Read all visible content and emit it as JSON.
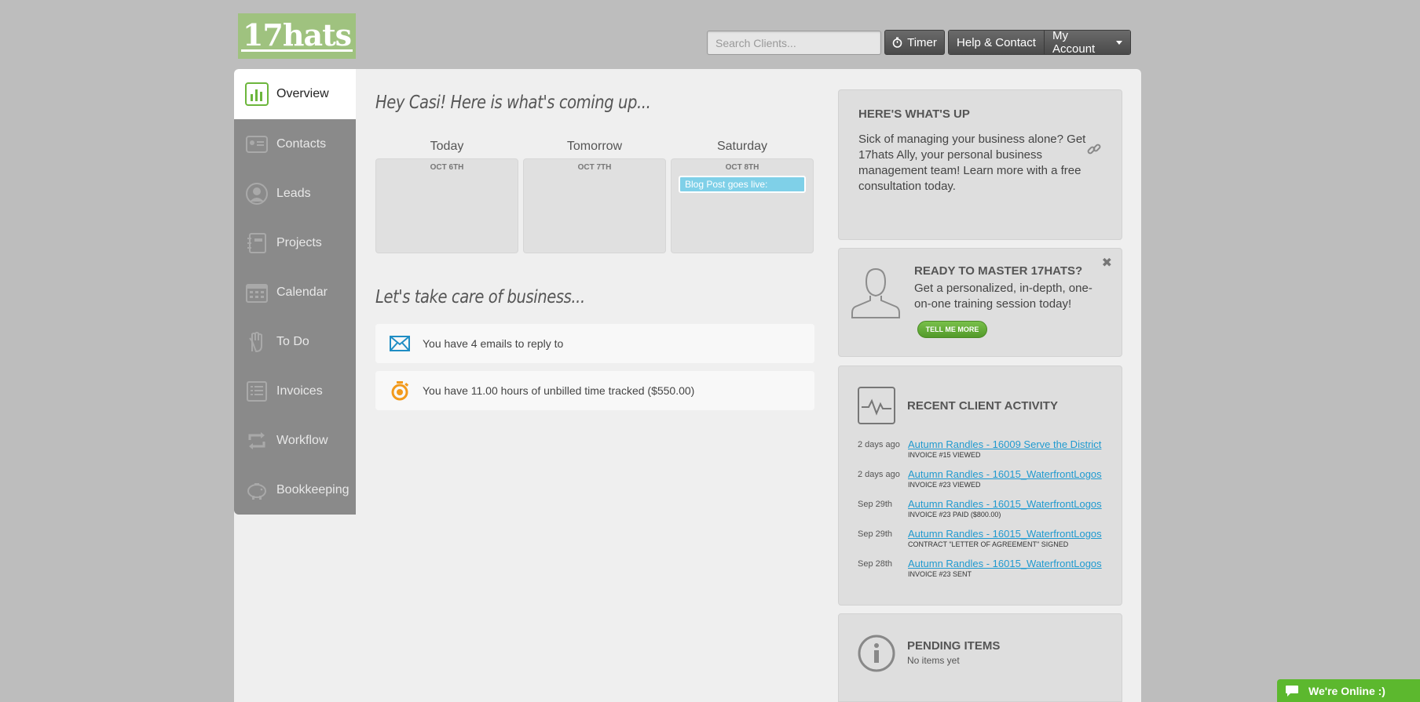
{
  "header": {
    "logo_text": "17hats",
    "search_placeholder": "Search Clients...",
    "timer_label": "Timer",
    "help_label": "Help & Contact",
    "account_label": "My Account"
  },
  "sidebar": {
    "items": [
      {
        "label": "Overview",
        "icon": "bar-chart-icon",
        "active": true
      },
      {
        "label": "Contacts",
        "icon": "contacts-icon"
      },
      {
        "label": "Leads",
        "icon": "person-circle-icon"
      },
      {
        "label": "Projects",
        "icon": "notebook-icon"
      },
      {
        "label": "Calendar",
        "icon": "calendar-icon"
      },
      {
        "label": "To Do",
        "icon": "hand-icon"
      },
      {
        "label": "Invoices",
        "icon": "invoice-icon"
      },
      {
        "label": "Workflow",
        "icon": "workflow-icon"
      },
      {
        "label": "Bookkeeping",
        "icon": "piggy-bank-icon"
      }
    ]
  },
  "main": {
    "greeting": "Hey Casi! Here is what's coming up...",
    "days": [
      {
        "name": "Today",
        "date": "OCT 6TH",
        "events": []
      },
      {
        "name": "Tomorrow",
        "date": "OCT 7TH",
        "events": []
      },
      {
        "name": "Saturday",
        "date": "OCT 8TH",
        "events": [
          "Blog Post goes live:"
        ]
      }
    ],
    "business_title": "Let's take care of business...",
    "tasks": [
      {
        "text": "You have 4 emails to reply to",
        "icon": "envelope-icon"
      },
      {
        "text": "You have 11.00 hours of unbilled time tracked ($550.00)",
        "icon": "stopwatch-icon"
      }
    ]
  },
  "whats_up": {
    "title": "HERE'S WHAT'S UP",
    "body": "Sick of managing your business alone? Get 17hats Ally, your personal business management team! Learn more with a free consultation today."
  },
  "master": {
    "title": "READY TO MASTER 17HATS?",
    "body": "Get a personalized, in-depth, one-on-one training session today!",
    "button": "TELL ME MORE",
    "close": "✖"
  },
  "activity": {
    "title": "RECENT CLIENT ACTIVITY",
    "items": [
      {
        "date": "2 days ago",
        "link": "Autumn Randles - 16009 Serve the District",
        "detail": "INVOICE #15 VIEWED"
      },
      {
        "date": "2 days ago",
        "link": "Autumn Randles - 16015_WaterfrontLogos",
        "detail": "INVOICE #23 VIEWED"
      },
      {
        "date": "Sep 29th",
        "link": "Autumn Randles - 16015_WaterfrontLogos",
        "detail": "INVOICE #23 PAID ($800.00)"
      },
      {
        "date": "Sep 29th",
        "link": "Autumn Randles - 16015_WaterfrontLogos",
        "detail": "CONTRACT \"LETTER OF AGREEMENT\" SIGNED"
      },
      {
        "date": "Sep 28th",
        "link": "Autumn Randles - 16015_WaterfrontLogos",
        "detail": "INVOICE #23 SENT"
      }
    ]
  },
  "pending": {
    "title": "PENDING ITEMS",
    "subtitle": "No items yet"
  },
  "chat": {
    "label": "We're Online :)"
  }
}
